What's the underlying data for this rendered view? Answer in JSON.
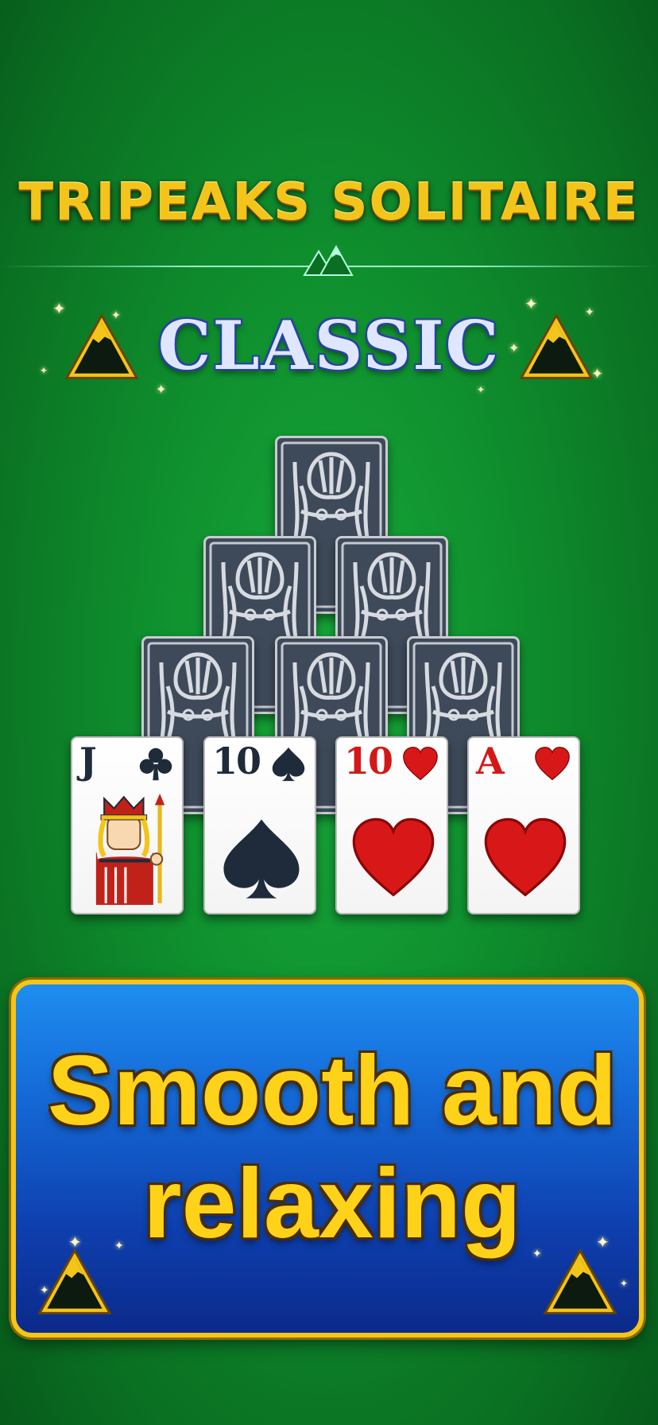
{
  "header": {
    "game_title": "TRIPEAKS SOLITAIRE",
    "edition": "CLASSIC"
  },
  "tableau": {
    "face_down_count": 6,
    "face_up_cards": [
      {
        "rank": "J",
        "suit": "clubs",
        "color": "black"
      },
      {
        "rank": "10",
        "suit": "spades",
        "color": "black"
      },
      {
        "rank": "10",
        "suit": "hearts",
        "color": "red"
      },
      {
        "rank": "A",
        "suit": "hearts",
        "color": "red"
      }
    ]
  },
  "banner": {
    "line1": "Smooth and",
    "line2": "relaxing"
  },
  "colors": {
    "felt": "#0f8f2e",
    "gold": "#f3c41a",
    "banner_blue": "#1466d4",
    "card_back": "#3e4a5a",
    "red_suit": "#d41818",
    "black_suit": "#1f2a3a"
  }
}
